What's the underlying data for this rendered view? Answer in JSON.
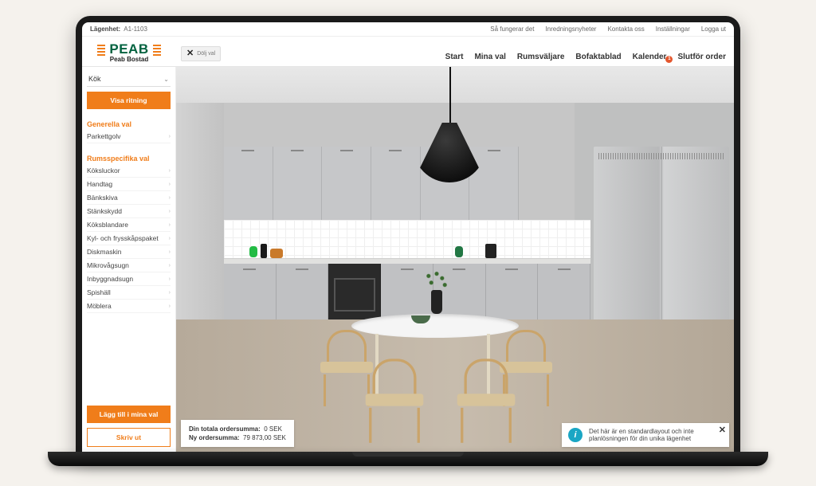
{
  "topbar": {
    "apartment_label": "Lägenhet:",
    "apartment_value": "A1-1103",
    "links": [
      "Så fungerar det",
      "Inredningsnyheter",
      "Kontakta oss",
      "Inställningar",
      "Logga ut"
    ]
  },
  "logo": {
    "text": "PEAB",
    "subtitle": "Peab Bostad"
  },
  "close_pill": "Dölj val",
  "tabs": {
    "items": [
      "Start",
      "Mina val",
      "Rumsväljare",
      "Bofaktablad",
      "Kalender",
      "Slutför order"
    ],
    "badge_on_index": 4,
    "badge_value": "1"
  },
  "sidebar": {
    "room_selected": "Kök",
    "show_drawing": "Visa ritning",
    "section_generic": "Generella val",
    "generic_items": [
      "Parkettgolv"
    ],
    "section_room": "Rumsspecifika val",
    "room_items": [
      "Köksluckor",
      "Handtag",
      "Bänkskiva",
      "Stänkskydd",
      "Köksblandare",
      "Kyl- och frysskåpspaket",
      "Diskmaskin",
      "Mikrovågsugn",
      "Inbyggnadsugn",
      "Spishäll",
      "Möblera"
    ],
    "add_to_choices": "Lägg till i mina val",
    "print": "Skriv ut"
  },
  "order_bar": {
    "label_total": "Din totala ordersumma:",
    "value_total": "0 SEK",
    "label_new": "Ny ordersumma:",
    "value_new": "79 873,00 SEK"
  },
  "info_bar": "Det här är en standardlayout och inte planlösningen för din unika lägenhet"
}
